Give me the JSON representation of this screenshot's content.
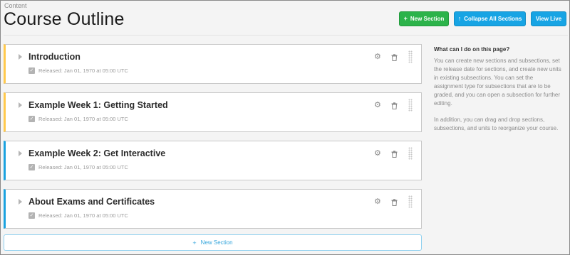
{
  "header": {
    "subtitle": "Content",
    "title": "Course Outline",
    "buttons": {
      "new_section": "New Section",
      "collapse_all": "Collapse All Sections",
      "view_live": "View Live"
    }
  },
  "sections": [
    {
      "title": "Introduction",
      "released": "Released: Jan 01, 1970 at 05:00 UTC",
      "accent": "#ffc94d"
    },
    {
      "title": "Example Week 1: Getting Started",
      "released": "Released: Jan 01, 1970 at 05:00 UTC",
      "accent": "#ffc94d"
    },
    {
      "title": "Example Week 2: Get Interactive",
      "released": "Released: Jan 01, 1970 at 05:00 UTC",
      "accent": "#1aa2df"
    },
    {
      "title": "About Exams and Certificates",
      "released": "Released: Jan 01, 1970 at 05:00 UTC",
      "accent": "#1aa2df"
    }
  ],
  "footer": {
    "new_section": "New Section"
  },
  "help": {
    "title": "What can I do on this page?",
    "p1": "You can create new sections and subsections, set the release date for sections, and create new units in existing subsections. You can set the assignment type for subsections that are to be graded, and you can open a subsection for further editing.",
    "p2": "In addition, you can drag and drop sections, subsections, and units to reorganize your course."
  },
  "colors": {
    "green": "#2cb34a",
    "blue": "#17a4e4",
    "yellow_accent": "#ffc94d",
    "blue_accent": "#1aa2df"
  }
}
